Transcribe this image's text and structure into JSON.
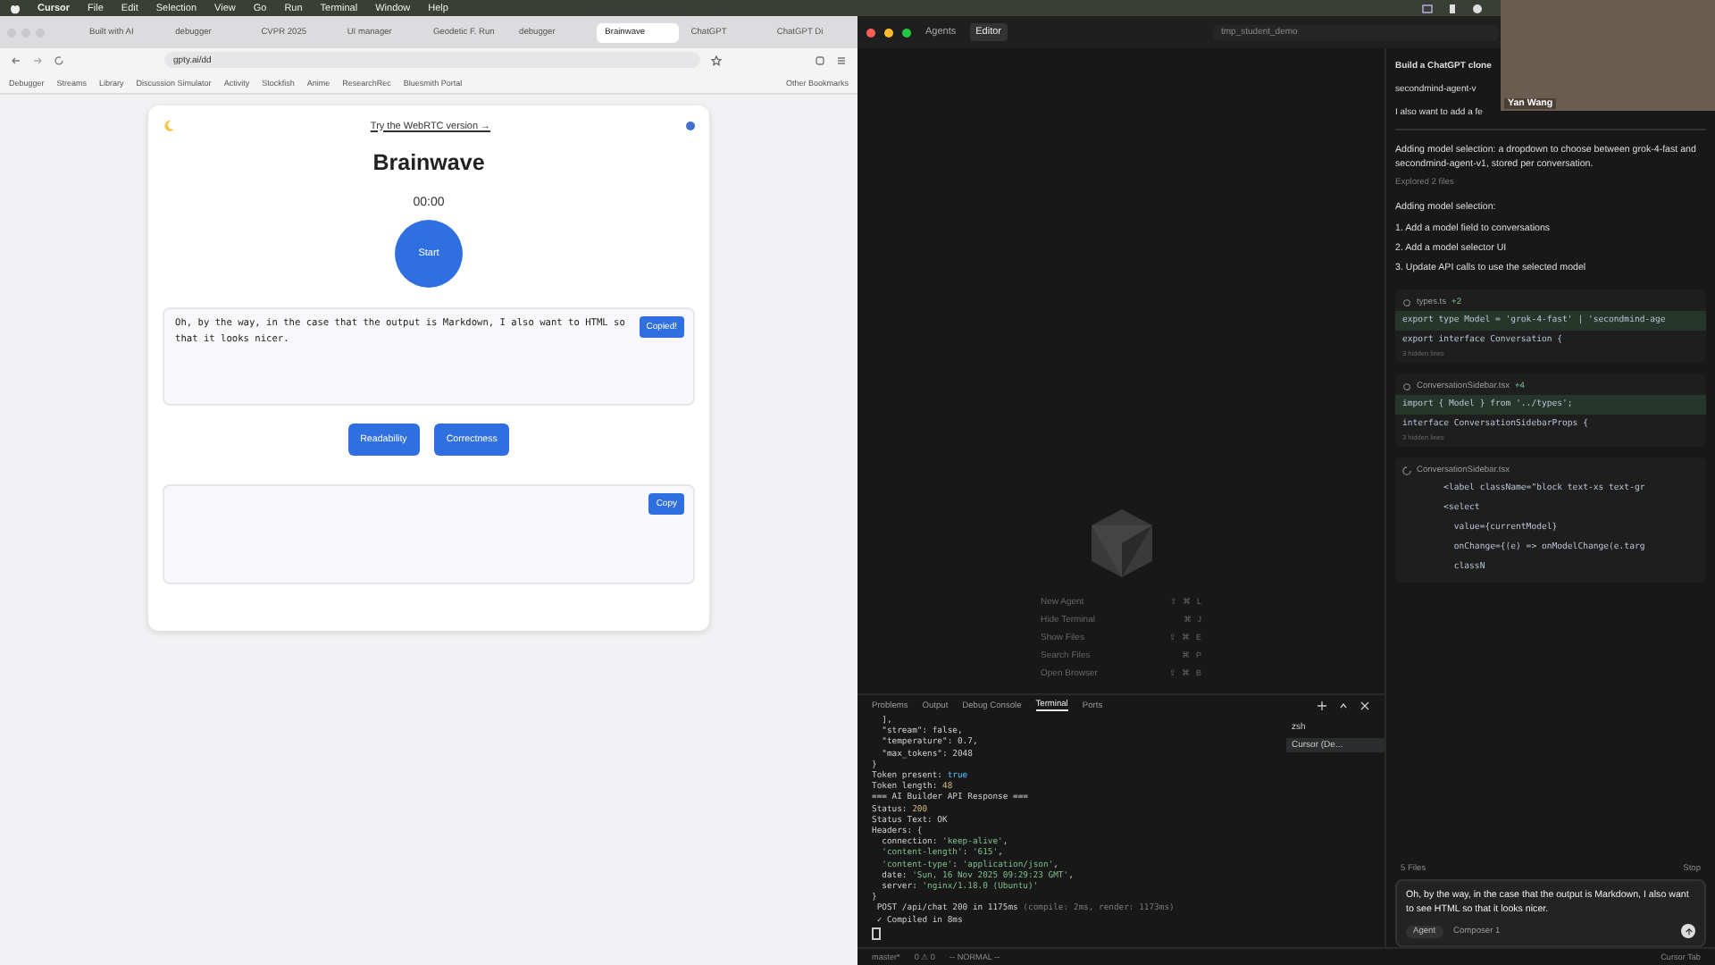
{
  "menu_bar": {
    "app": "Cursor",
    "items": [
      "File",
      "Edit",
      "Selection",
      "View",
      "Go",
      "Run",
      "Terminal",
      "Window",
      "Help"
    ]
  },
  "browser": {
    "tabs": [
      {
        "label": "Built with AI",
        "selected": false
      },
      {
        "label": "debugger",
        "selected": false
      },
      {
        "label": "CVPR 2025",
        "selected": false
      },
      {
        "label": "UI manager",
        "selected": false
      },
      {
        "label": "Geodetic F. Run",
        "selected": false
      },
      {
        "label": "debugger",
        "selected": false
      },
      {
        "label": "Brainwave",
        "selected": true
      },
      {
        "label": "ChatGPT",
        "selected": false
      },
      {
        "label": "ChatGPT Di",
        "selected": false
      }
    ],
    "address": "gpty.ai/dd",
    "bookmarks": [
      "Debugger",
      "Streams",
      "Library",
      "Discussion Simulator",
      "Activity",
      "Stockfish",
      "Anime",
      "ResearchRec",
      "Bluesmith Portal"
    ],
    "other_bookmarks": "Other Bookmarks",
    "page": {
      "link": "Try the WebRTC version →",
      "title": "Brainwave",
      "timer": "00:00",
      "start_button": "Start",
      "transcript": "Oh, by the way, in the case that the output is Markdown, I also want to HTML so that it looks nicer.",
      "copied_button": "Copied!",
      "actions": [
        "Readability",
        "Correctness"
      ],
      "copy_button": "Copy"
    }
  },
  "editor": {
    "modes": [
      {
        "label": "Agents",
        "selected": false
      },
      {
        "label": "Editor",
        "selected": true
      }
    ],
    "search": "tmp_student_demo",
    "shortcuts": [
      {
        "label": "New Agent",
        "keys": [
          "⇧",
          "⌘",
          "L"
        ]
      },
      {
        "label": "Hide Terminal",
        "keys": [
          "⌘",
          "J"
        ]
      },
      {
        "label": "Show Files",
        "keys": [
          "⇧",
          "⌘",
          "E"
        ]
      },
      {
        "label": "Search Files",
        "keys": [
          "⌘",
          "P"
        ]
      },
      {
        "label": "Open Browser",
        "keys": [
          "⇧",
          "⌘",
          "B"
        ]
      }
    ],
    "panel_tabs": [
      {
        "label": "Problems",
        "selected": false
      },
      {
        "label": "Output",
        "selected": false
      },
      {
        "label": "Debug Console",
        "selected": false
      },
      {
        "label": "Terminal",
        "selected": true
      },
      {
        "label": "Ports",
        "selected": false
      }
    ],
    "terminal_lines": [
      [
        {
          "text": "  ],",
          "kind": "plain"
        }
      ],
      [
        {
          "text": "  \"stream\": false,",
          "kind": "plain"
        }
      ],
      [
        {
          "text": "  \"temperature\": 0.7,",
          "kind": "plain"
        }
      ],
      [
        {
          "text": "  \"max_tokens\": 2048",
          "kind": "plain"
        }
      ],
      [
        {
          "text": "}",
          "kind": "plain"
        }
      ],
      [
        {
          "text": "Token present: ",
          "kind": "plain"
        },
        {
          "text": "true",
          "kind": "keyword"
        }
      ],
      [
        {
          "text": "Token length: ",
          "kind": "plain"
        },
        {
          "text": "48",
          "kind": "number"
        }
      ],
      [
        {
          "text": "=== AI Builder API Response ===",
          "kind": "plain"
        }
      ],
      [
        {
          "text": "Status: ",
          "kind": "plain"
        },
        {
          "text": "200",
          "kind": "number"
        }
      ],
      [
        {
          "text": "Status Text: OK",
          "kind": "plain"
        }
      ],
      [
        {
          "text": "Headers: {",
          "kind": "plain"
        }
      ],
      [
        {
          "text": "  connection: ",
          "kind": "plain"
        },
        {
          "text": "'keep-alive'",
          "kind": "string"
        },
        {
          "text": ",",
          "kind": "plain"
        }
      ],
      [
        {
          "text": "  'content-length'",
          "kind": "string"
        },
        {
          "text": ": ",
          "kind": "plain"
        },
        {
          "text": "'615'",
          "kind": "string"
        },
        {
          "text": ",",
          "kind": "plain"
        }
      ],
      [
        {
          "text": "  'content-type'",
          "kind": "string"
        },
        {
          "text": ": ",
          "kind": "plain"
        },
        {
          "text": "'application/json'",
          "kind": "string"
        },
        {
          "text": ",",
          "kind": "plain"
        }
      ],
      [
        {
          "text": "  date: ",
          "kind": "plain"
        },
        {
          "text": "'Sun, 16 Nov 2025 09:29:23 GMT'",
          "kind": "string"
        },
        {
          "text": ",",
          "kind": "plain"
        }
      ],
      [
        {
          "text": "  server: ",
          "kind": "plain"
        },
        {
          "text": "'nginx/1.18.0 (Ubuntu)'",
          "kind": "string"
        }
      ],
      [
        {
          "text": "}",
          "kind": "plain"
        }
      ],
      [
        {
          "text": " POST /api/chat 200 in 1175ms ",
          "kind": "plain"
        },
        {
          "text": "(compile: 2ms, render: 1173ms)",
          "kind": "dim"
        }
      ],
      [
        {
          "text": " ✓ Compiled in 8ms",
          "kind": "plain"
        }
      ]
    ],
    "sessions": [
      {
        "label": "zsh",
        "selected": false
      },
      {
        "label": "Cursor (De...",
        "selected": true
      }
    ],
    "status_bar": {
      "branch": "master*",
      "problems": "0 ⚠ 0",
      "mode": "-- NORMAL --",
      "cursor_tab": "Cursor Tab"
    }
  },
  "chat": {
    "intro": [
      "Build a ChatGPT clone",
      "secondmind-agent-v",
      "I also want to add a fe"
    ],
    "summary": "Adding model selection: a dropdown to choose between grok-4-fast and secondmind-agent-v1, stored per conversation.",
    "explored": "Explored 2 files",
    "plan_title": "Adding model selection:",
    "plan": [
      "1. Add a model field to conversations",
      "2. Add a model selector UI",
      "3. Update API calls to use the selected model"
    ],
    "files": [
      {
        "name": "types.ts",
        "delta": "+2",
        "kind": "done",
        "lines": [
          {
            "text": "export type Model = 'grok-4-fast' | 'secondmind-age",
            "added": true
          },
          {
            "text": "export interface Conversation {",
            "added": false
          }
        ],
        "hidden": "3 hidden lines"
      },
      {
        "name": "ConversationSidebar.tsx",
        "delta": "+4",
        "kind": "done",
        "lines": [
          {
            "text": "import { Model } from '../types';",
            "added": true
          },
          {
            "text": "interface ConversationSidebarProps {",
            "added": false
          }
        ],
        "hidden": "3 hidden lines"
      },
      {
        "name": "ConversationSidebar.tsx",
        "kind": "loading",
        "lines": [
          {
            "text": "        <label className=\"block text-xs text-gr",
            "added": false
          },
          {
            "text": "        <select",
            "added": false
          },
          {
            "text": "          value={currentModel}",
            "added": false
          },
          {
            "text": "          onChange={(e) => onModelChange(e.targ",
            "added": false
          },
          {
            "text": "          classN",
            "added": false
          }
        ]
      }
    ],
    "files_count": "5 Files",
    "stop": "Stop",
    "composer_text": "Oh, by the way, in the case that the output is Markdown, I also want to see HTML so that it looks nicer.",
    "agent_mode": "Agent",
    "model": "Composer 1"
  },
  "video": {
    "name": "Yan Wang"
  }
}
